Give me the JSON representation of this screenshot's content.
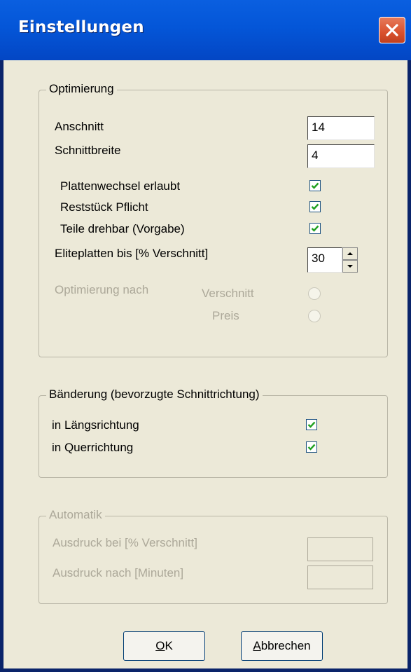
{
  "window": {
    "title": "Einstellungen"
  },
  "optimierung": {
    "legend": "Optimierung",
    "anschnitt_label": "Anschnitt",
    "anschnitt_value": "14",
    "schnittbreite_label": "Schnittbreite",
    "schnittbreite_value": "4",
    "plattenwechsel_label": "Plattenwechsel erlaubt",
    "plattenwechsel_checked": true,
    "reststueck_label": "Reststück Pflicht",
    "reststueck_checked": true,
    "drehbar_label": "Teile drehbar (Vorgabe)",
    "drehbar_checked": true,
    "eliteplatten_label": "Eliteplatten bis [% Verschnitt]",
    "eliteplatten_value": "30",
    "optimierung_nach_label": "Optimierung nach",
    "option_verschnitt": "Verschnitt",
    "option_preis": "Preis"
  },
  "baenderung": {
    "legend": "Bänderung (bevorzugte Schnittrichtung)",
    "laengs_label": "in Längsrichtung",
    "laengs_checked": true,
    "quer_label": "in Querrichtung",
    "quer_checked": true
  },
  "automatik": {
    "legend": "Automatik",
    "ausdruck_verschnitt_label": "Ausdruck bei [% Verschnitt]",
    "ausdruck_minuten_label": "Ausdruck nach [Minuten]"
  },
  "buttons": {
    "ok_mnemonic": "O",
    "ok_rest": "K",
    "cancel_mnemonic": "A",
    "cancel_rest": "bbrechen"
  }
}
